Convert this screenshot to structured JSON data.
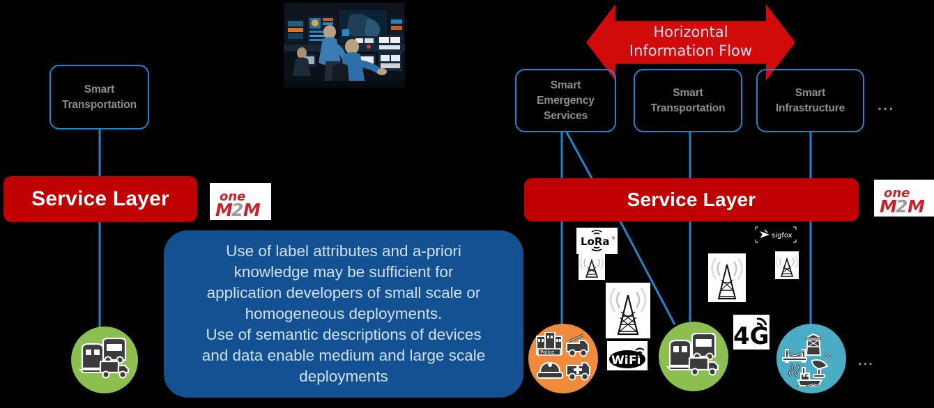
{
  "diagram": {
    "title": "IoT Service Layer Semantic Interoperability Diagram",
    "colors": {
      "service_bar": "#c00000",
      "domain_border": "#1a87d0",
      "domain_text": "#8f8f8f",
      "info_box": "#135193",
      "info_text": "#cfe0f0",
      "arrow_red": "#d10a0a",
      "connector_blue": "#1a87d0",
      "circle_green": "#8cbf50",
      "circle_orange": "#f08a3c",
      "circle_teal": "#4bacc6",
      "logo_red": "#cc2229",
      "logo_gray": "#9b9b9b"
    },
    "left_side": {
      "domain_box": {
        "line1": "Smart",
        "line2": "Transportation"
      },
      "service_layer_label": "Service Layer",
      "onem2m_logo": {
        "top": "one",
        "bottom_m1": "M",
        "bottom_2": "2",
        "bottom_m2": "M"
      },
      "node_circle": {
        "icon": "transport-icons",
        "color": "#8cbf50"
      }
    },
    "photo": {
      "caption": "control-room-operators-photo"
    },
    "info_box": {
      "lines": [
        "Use of label attributes and a-priori",
        "knowledge may be sufficient for",
        "application developers of small scale or",
        "homogeneous deployments.",
        "Use of semantic descriptions of devices",
        "and data enable medium and large scale",
        "deployments"
      ]
    },
    "right_side": {
      "arrow": {
        "line1": "Horizontal",
        "line2": "Information Flow",
        "direction": "double-headed"
      },
      "domain_boxes": [
        {
          "line1": "Smart",
          "line2": "Emergency",
          "line3": "Services"
        },
        {
          "line1": "Smart",
          "line2": "Transportation"
        },
        {
          "line1": "Smart",
          "line2": "Infrastructure"
        }
      ],
      "ellipsis_top": "...",
      "ellipsis_bottom": "...",
      "service_layer_label": "Service Layer",
      "onem2m_logo": {
        "top": "one",
        "bottom_m1": "M",
        "bottom_2": "2",
        "bottom_m2": "M"
      },
      "node_circles": [
        {
          "icon": "emergency-services-icons",
          "color": "#f08a3c"
        },
        {
          "icon": "transport-icons",
          "color": "#8cbf50"
        },
        {
          "icon": "infrastructure-icons",
          "color": "#4bacc6"
        }
      ],
      "tech_logos": [
        {
          "name": "lora-logo",
          "label": "LoRa"
        },
        {
          "name": "cell-tower-icon-1",
          "label": ""
        },
        {
          "name": "cell-tower-icon-2",
          "label": ""
        },
        {
          "name": "wifi-logo",
          "label": "Wi Fi"
        },
        {
          "name": "sigfox-logo",
          "label": "sigfox"
        },
        {
          "name": "cell-tower-icon-3",
          "label": ""
        },
        {
          "name": "cell-tower-icon-4",
          "label": ""
        },
        {
          "name": "fourg-logo",
          "label": "4G"
        }
      ]
    }
  }
}
